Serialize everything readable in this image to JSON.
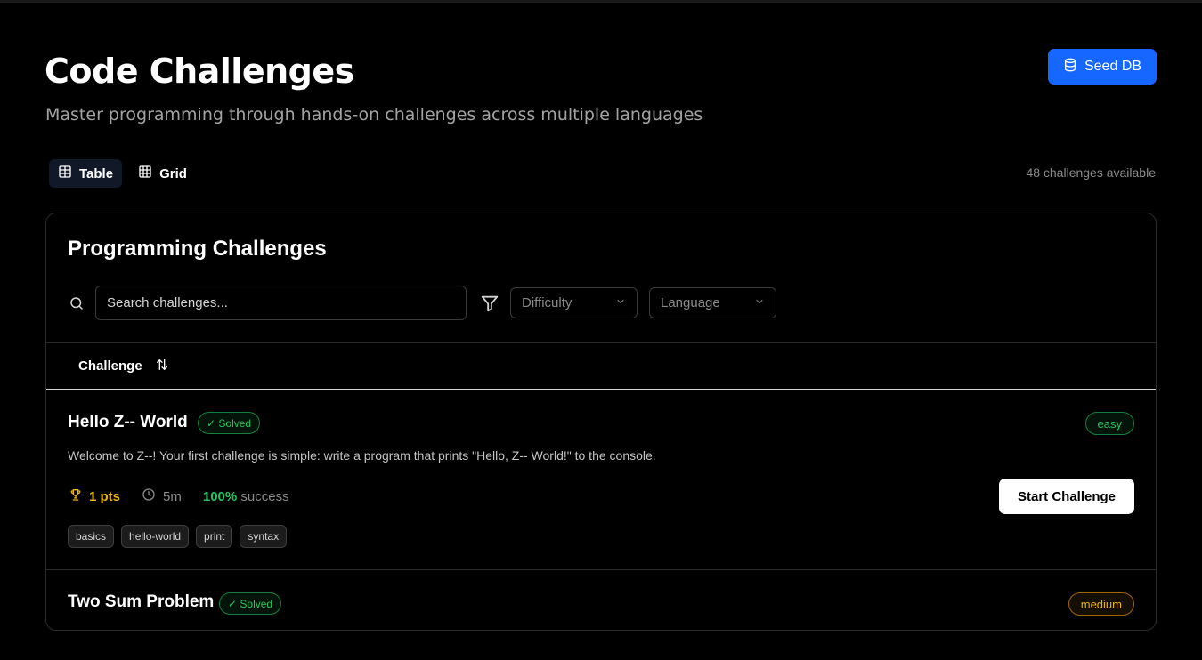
{
  "header": {
    "title": "Code Challenges",
    "subtitle": "Master programming through hands-on challenges across multiple languages",
    "seed_button": "Seed DB"
  },
  "view_toggle": {
    "table_label": "Table",
    "grid_label": "Grid",
    "active": "Table"
  },
  "count_text": "48 challenges available",
  "card": {
    "title": "Programming Challenges",
    "search_placeholder": "Search challenges...",
    "difficulty_placeholder": "Difficulty",
    "language_placeholder": "Language",
    "column_header": "Challenge"
  },
  "challenges": [
    {
      "name": "Hello Z-- World",
      "solved_label": "✓ Solved",
      "difficulty": "easy",
      "description": "Welcome to Z--! Your first challenge is simple: write a program that prints \"Hello, Z-- World!\" to the console.",
      "points": "1 pts",
      "time": "5m",
      "success_pct": "100%",
      "success_label": "success",
      "start_label": "Start Challenge",
      "tags": [
        "basics",
        "hello-world",
        "print",
        "syntax"
      ]
    },
    {
      "name": "Two Sum Problem",
      "solved_label": "✓ Solved",
      "difficulty": "medium"
    }
  ],
  "colors": {
    "accent": "#1667ff",
    "success": "#22c55e",
    "warning": "#eab308",
    "background": "#000000"
  }
}
